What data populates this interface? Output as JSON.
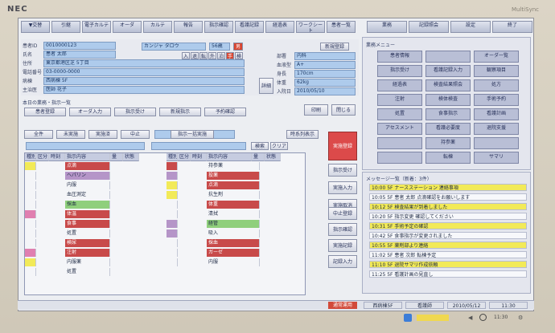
{
  "monitor": {
    "brand": "NEC",
    "model": "MultiSync"
  },
  "nav_tabs": [
    "▼交替",
    "引継",
    "電子カルテ",
    "オーダ",
    "カルテ",
    "報告",
    "指示確認",
    "看護記録",
    "経過表",
    "ワークシート",
    "患者一覧",
    "業務",
    "記録照会",
    "設定",
    "終了"
  ],
  "patient": {
    "labels": [
      "患者ID",
      "氏名",
      "住所",
      "電話番号",
      "病棟",
      "主治医"
    ],
    "values": [
      "0010000123",
      "患者 太郎",
      "東京都港区芝 5丁目",
      "03-0000-0000",
      "西病棟 5F",
      "医師 花子"
    ],
    "kana": "カンジャ タロウ",
    "age": "56歳",
    "gender_btn": "男",
    "right_labels": [
      "部署",
      "血液型",
      "身長",
      "体重",
      "入院日"
    ],
    "right_values": [
      "内科",
      "A+",
      "170cm",
      "62kg",
      "2010/05/10"
    ],
    "register_btn": "新規登録",
    "small_buttons": [
      "入",
      "退",
      "転",
      "外",
      "泊",
      "手",
      "検"
    ],
    "side_btn": "詳細"
  },
  "quick_actions": {
    "title": "本日の業務・指示一覧",
    "buttons": [
      "患者登録",
      "オーダ入力",
      "指示受け",
      "新規指示",
      "予約確認"
    ],
    "side_buttons": [
      "印刷",
      "閉じる"
    ]
  },
  "filters": {
    "row1": [
      "全件",
      "未実施",
      "実施済",
      "中止"
    ],
    "row2": [
      "検索",
      "クリア"
    ],
    "select_btn": "指示一括実施",
    "type_btn": "時系列表示"
  },
  "table": {
    "left_header": [
      "種別",
      "区分",
      "時刻",
      "指示内容",
      "量",
      "状態"
    ],
    "right_header": [
      "種別",
      "区分",
      "時刻",
      "指示内容",
      "量",
      "状態"
    ],
    "rows_left": [
      "点滴",
      "ヘパリン",
      "内服",
      "血圧測定",
      "採血",
      "体温",
      "食事",
      "処置",
      "検尿",
      "注射",
      "内服薬",
      "処置"
    ],
    "rows_right": [
      "持参薬",
      "投薬",
      "点滴",
      "抗生剤",
      "体重",
      "清拭",
      "経管",
      "吸入",
      "採血",
      "ガーゼ",
      "内服"
    ]
  },
  "right_buttons": [
    "指示受け",
    "実施入力",
    "実施取消",
    "中止登録",
    "指示確認",
    "実施記録",
    "記録入力"
  ],
  "right_panel": {
    "title": "業務メニュー",
    "grid": [
      "患者情報",
      "",
      "オーダ一覧",
      "指示受け",
      "看護記録入力",
      "観察項目",
      "経過表",
      "検査結果照会",
      "処方",
      "注射",
      "検体検査",
      "手術予約",
      "処置",
      "食事指示",
      "看護計画",
      "アセスメント",
      "看護必要度",
      "退院支援",
      "",
      "持参薬",
      "",
      "",
      "転棟",
      "サマリ"
    ],
    "messages_title": "メッセージ一覧（新着：3件）",
    "messages": [
      "10:00 5F ナースステーション 連絡事項",
      "10:05 5F 患者 太郎 点滴確認をお願いします",
      "10:12 5F 検査結果が到着しました",
      "10:20 5F 指示変更 確認してください",
      "10:31 5F 手術予定の確認",
      "10:42 5F 食事指示が変更されました",
      "10:55 5F 薬剤部より連絡",
      "11:02 5F 患者 次郎 転棟予定",
      "11:10 5F 退院サマリ作成依頼",
      "11:25 5F 看護計画の見直し"
    ]
  },
  "status_bar": {
    "left": "通常運用",
    "items": [
      "西病棟5F",
      "看護師",
      "2010/05/12",
      "11:30"
    ]
  },
  "taskbar": {
    "time": "11:30"
  }
}
